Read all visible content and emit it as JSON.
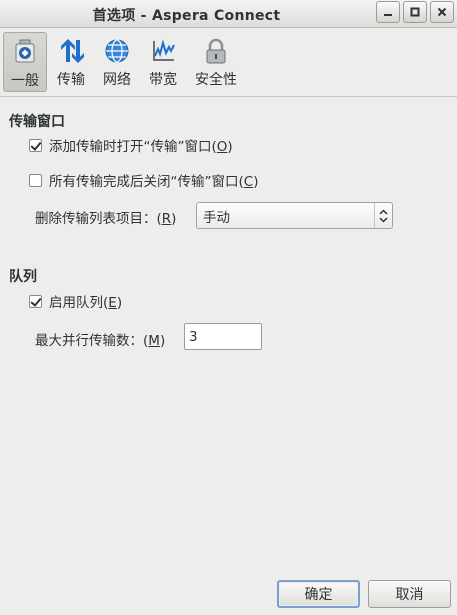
{
  "window": {
    "title": "首选项  -  Aspera Connect",
    "controls": [
      "minimize-icon",
      "maximize-icon",
      "close-icon"
    ]
  },
  "toolbar": {
    "tabs": [
      {
        "label": "一般",
        "icon": "general-icon",
        "active": true
      },
      {
        "label": "传输",
        "icon": "transfer-arrows-icon",
        "active": false
      },
      {
        "label": "网络",
        "icon": "globe-icon",
        "active": false
      },
      {
        "label": "带宽",
        "icon": "bandwidth-icon",
        "active": false
      },
      {
        "label": "安全性",
        "icon": "lock-icon",
        "active": false
      }
    ]
  },
  "transfer_window": {
    "heading": "传输窗口",
    "open_on_add": {
      "label": "添加传输时打开“传输”窗口(",
      "mnemonic": "O",
      "tail": ")",
      "checked": true
    },
    "close_on_complete": {
      "label": "所有传输完成后关闭“传输”窗口(",
      "mnemonic": "C",
      "tail": ")",
      "checked": false
    },
    "remove_items": {
      "label": "删除传输列表项目：(",
      "mnemonic": "R",
      "tail": ")",
      "selected": "手动"
    }
  },
  "queue": {
    "heading": "队列",
    "enable_queue": {
      "label": "启用队列(",
      "mnemonic": "E",
      "tail": ")",
      "checked": true
    },
    "max_parallel": {
      "label": "最大并行传输数：(",
      "mnemonic": "M",
      "tail": ")",
      "value": "3"
    }
  },
  "buttons": {
    "ok": "确定",
    "cancel": "取消"
  },
  "colors": {
    "window_bg": "#ededec",
    "default_button_border": "#7e9fcb"
  }
}
